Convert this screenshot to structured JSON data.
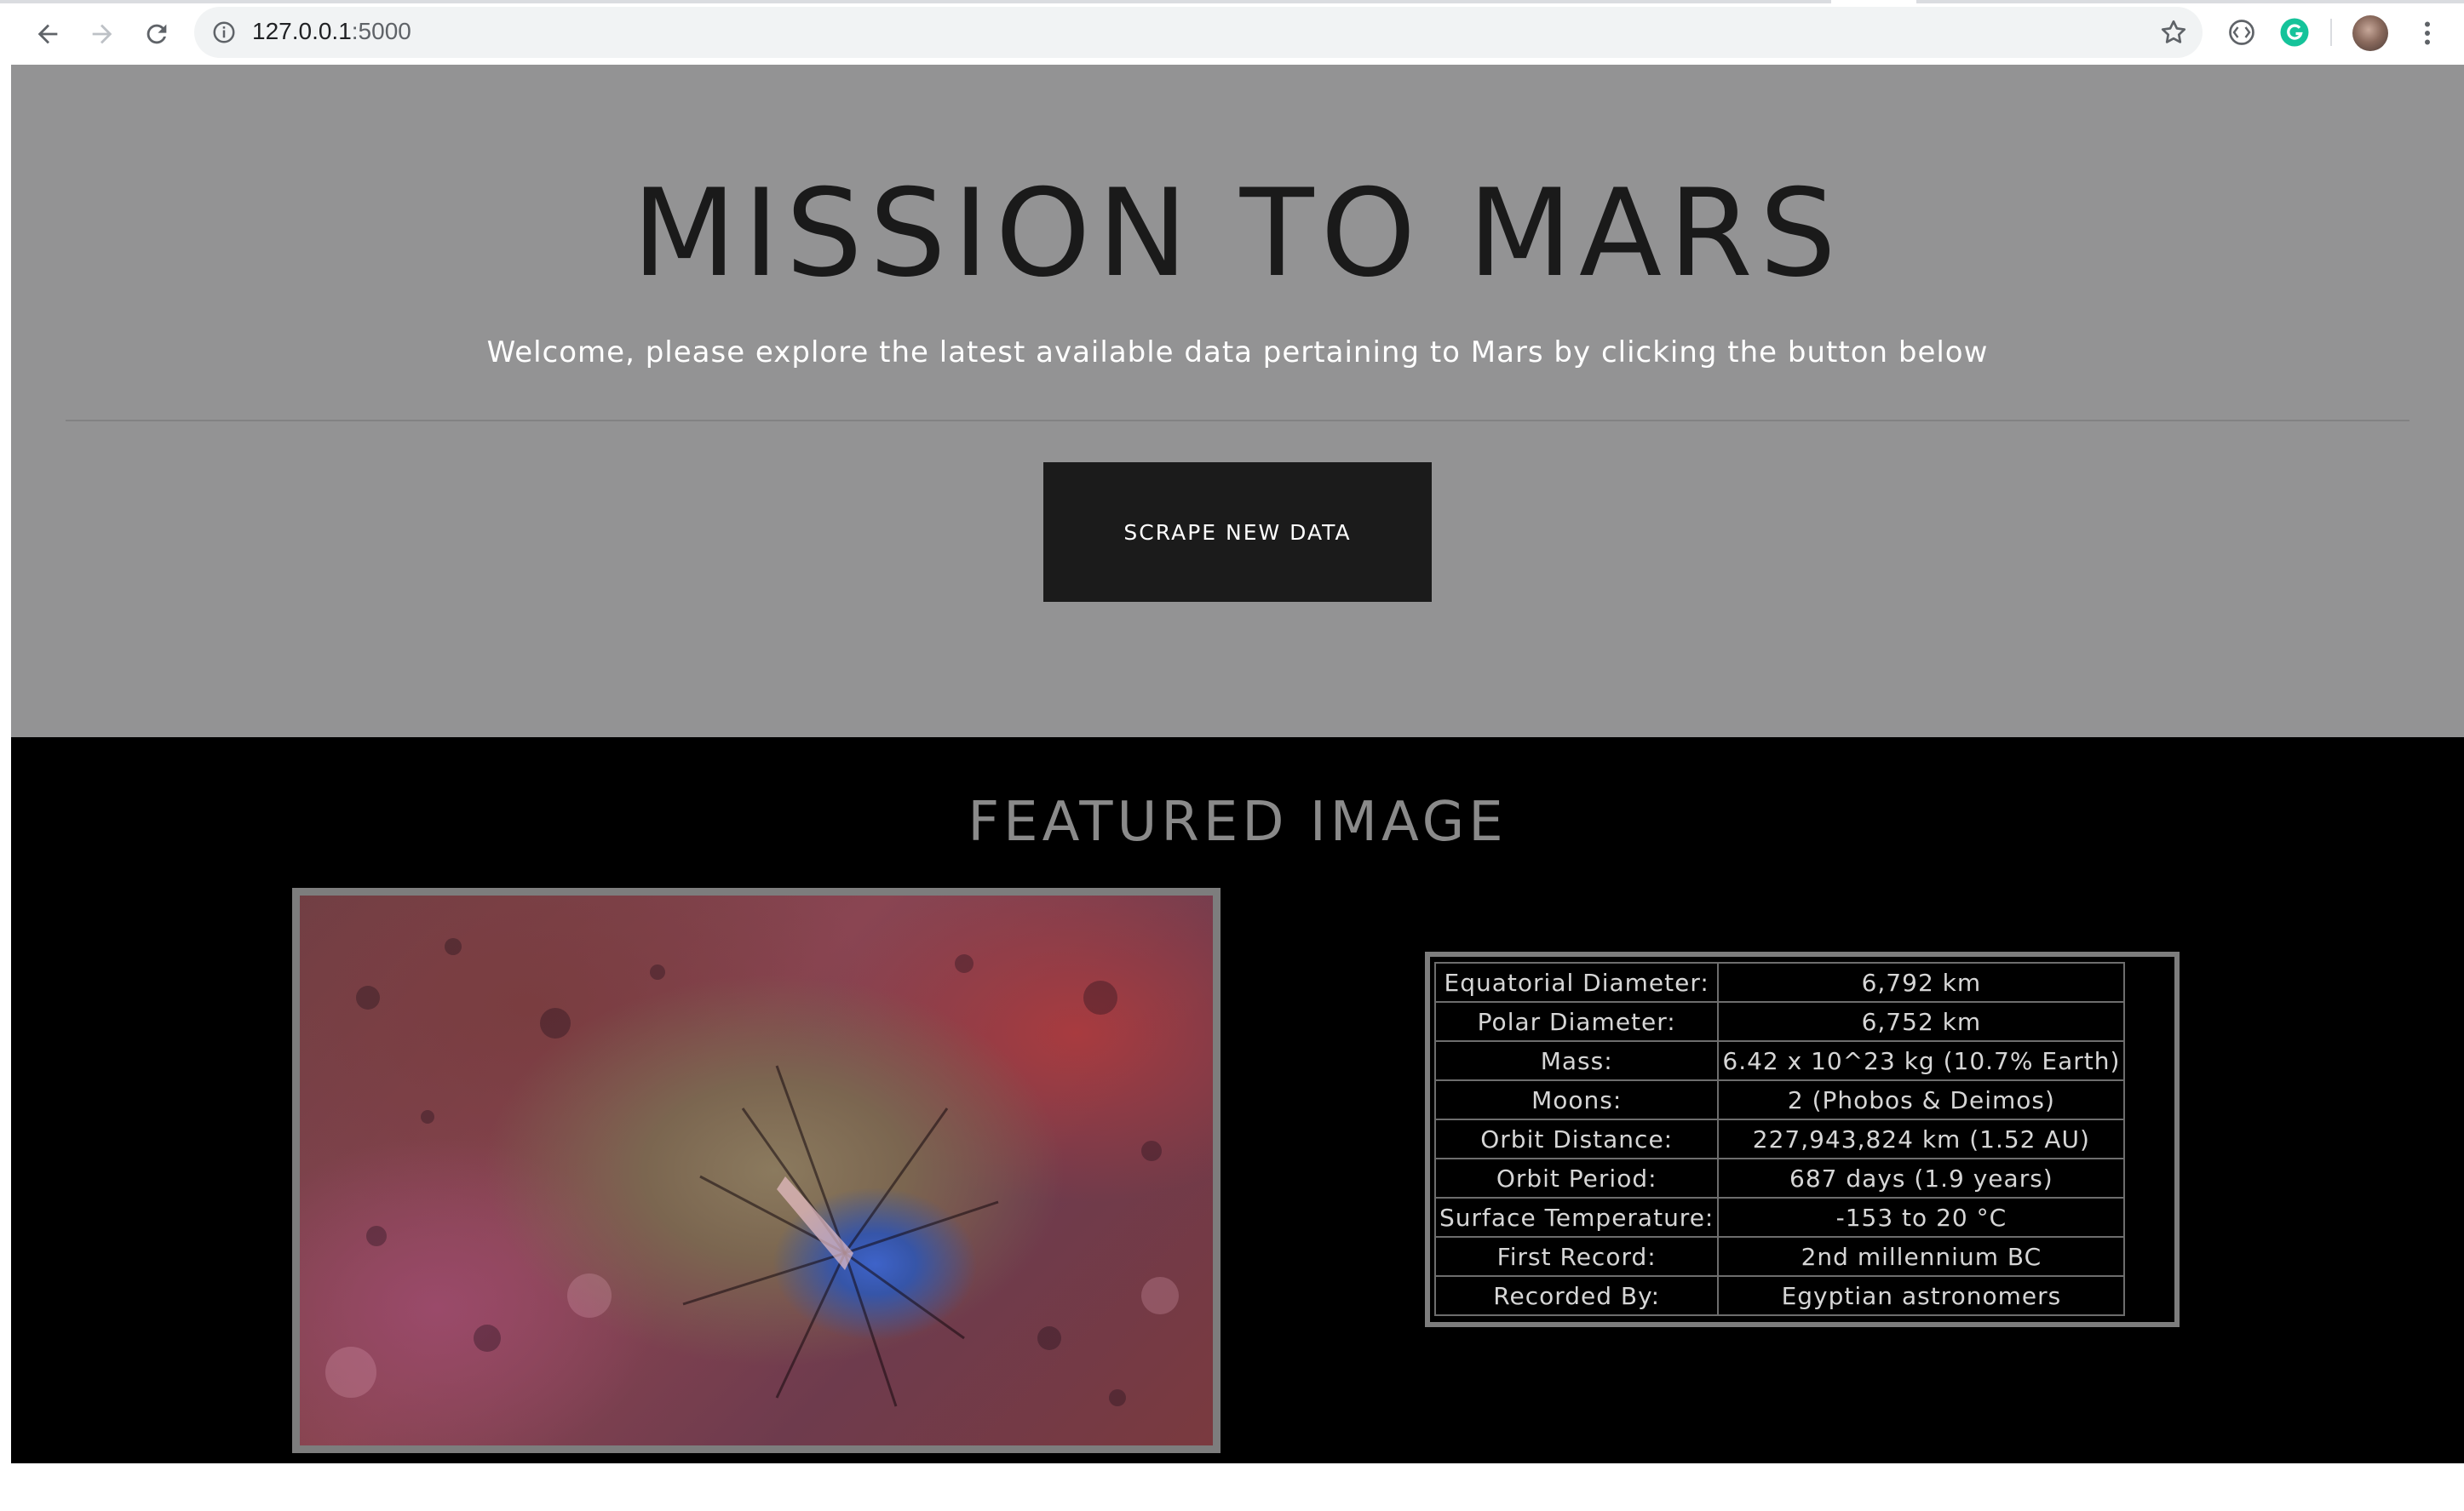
{
  "browser": {
    "url_host": "127.0.0.1",
    "url_port": ":5000",
    "icons": [
      "back-arrow-icon",
      "forward-arrow-icon",
      "reload-icon",
      "site-info-icon",
      "bookmark-star-icon",
      "extension-icon",
      "grammarly-icon",
      "profile-avatar",
      "kebab-menu-icon"
    ]
  },
  "hero": {
    "title": "MISSION TO MARS",
    "subtitle": "Welcome, please explore the latest available data pertaining to Mars by clicking the button below",
    "button_label": "SCRAPE NEW DATA"
  },
  "featured": {
    "title": "FEATURED IMAGE"
  },
  "facts": [
    {
      "label": "Equatorial Diameter:",
      "value": "6,792 km"
    },
    {
      "label": "Polar Diameter:",
      "value": "6,752 km"
    },
    {
      "label": "Mass:",
      "value": "6.42 x 10^23 kg (10.7% Earth)"
    },
    {
      "label": "Moons:",
      "value": "2 (Phobos & Deimos)"
    },
    {
      "label": "Orbit Distance:",
      "value": "227,943,824 km (1.52 AU)"
    },
    {
      "label": "Orbit Period:",
      "value": "687 days (1.9 years)"
    },
    {
      "label": "Surface Temperature:",
      "value": "-153 to 20 °C"
    },
    {
      "label": "First Record:",
      "value": "2nd millennium BC"
    },
    {
      "label": "Recorded By:",
      "value": "Egyptian astronomers"
    }
  ],
  "colors": {
    "hero_bg": "#939394",
    "featured_bg": "#000000",
    "button_bg": "#1b1b1b",
    "grammarly": "#15c39a"
  }
}
